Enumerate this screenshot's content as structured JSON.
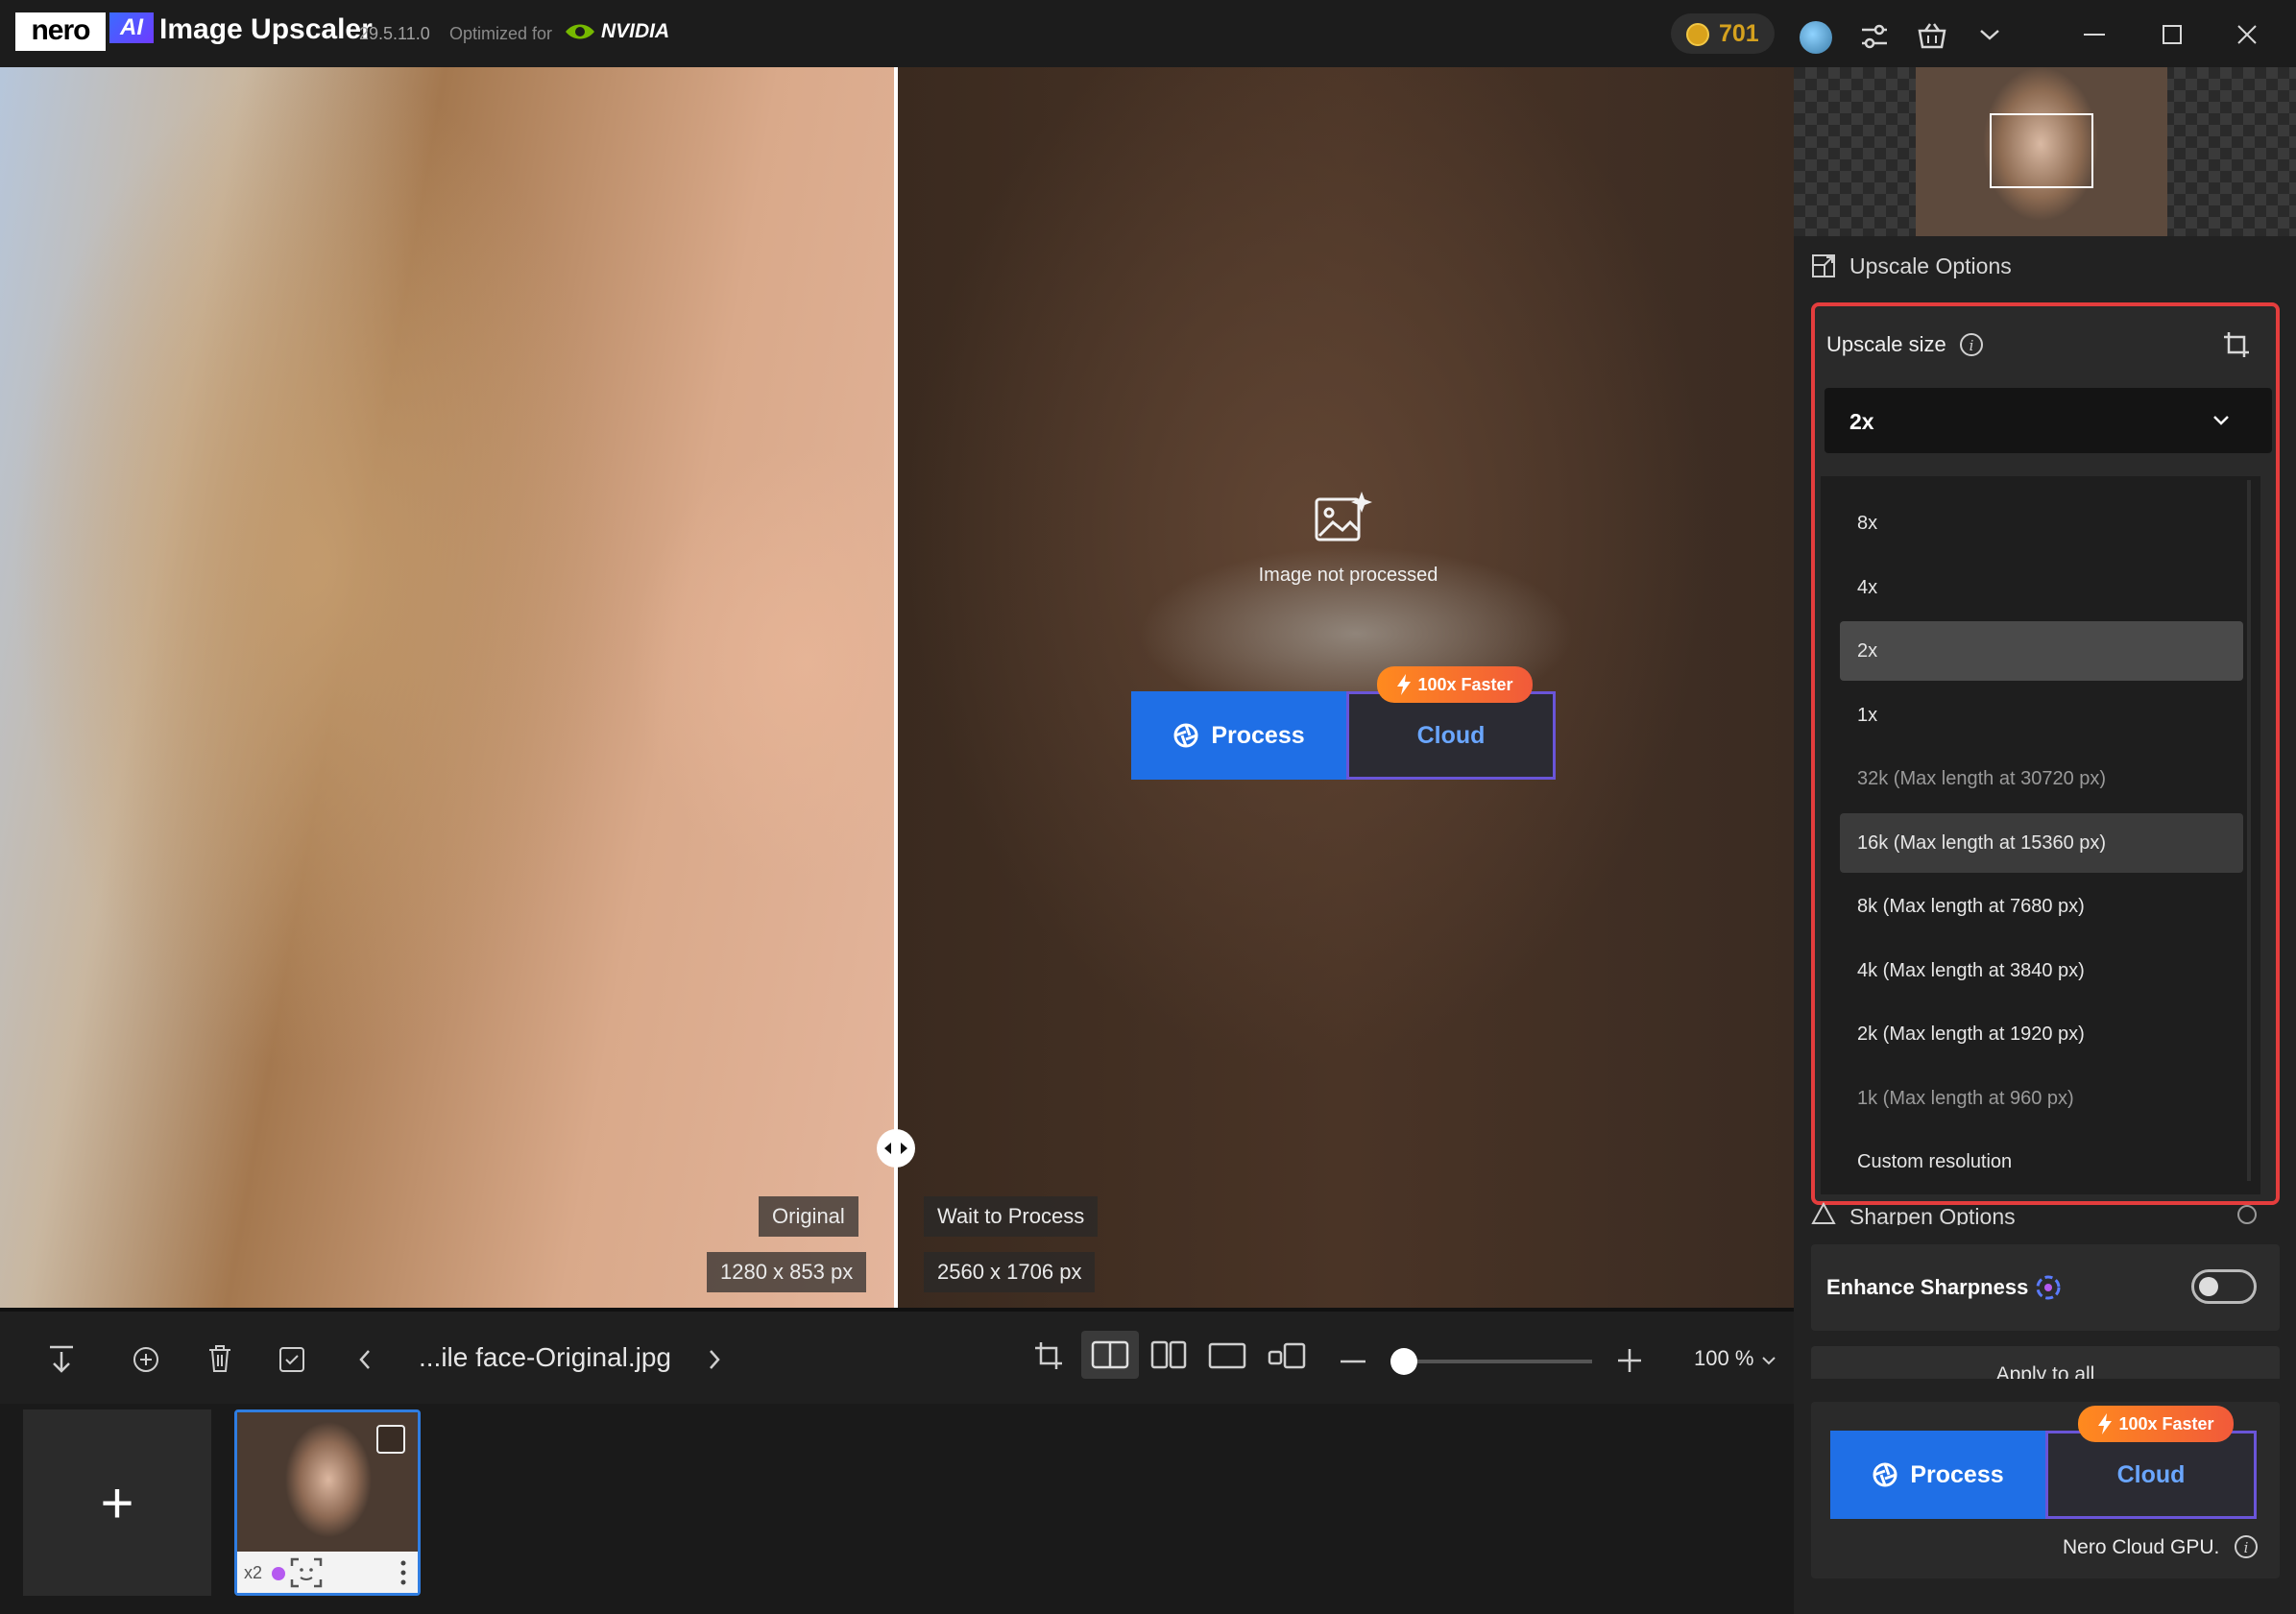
{
  "titlebar": {
    "brand": "nero",
    "ai_badge": "AI",
    "app_name": "Image Upscaler",
    "version": "29.5.11.0",
    "optimized_for": "Optimized for",
    "nvidia": "NVIDIA",
    "credits": "701"
  },
  "canvas": {
    "original_label": "Original",
    "original_size": "1280 x 853 px",
    "processed_label": "Wait to Process",
    "processed_size": "2560 x 1706 px",
    "not_processed": "Image not processed",
    "process_button": "Process",
    "cloud_button": "Cloud",
    "faster_badge": "100x Faster"
  },
  "panel": {
    "upscale_options_title": "Upscale Options",
    "upscale_size_label": "Upscale size",
    "selected_size": "2x",
    "menu_items": [
      {
        "label": "8x",
        "state": "normal"
      },
      {
        "label": "4x",
        "state": "normal"
      },
      {
        "label": "2x",
        "state": "selected"
      },
      {
        "label": "1x",
        "state": "normal"
      },
      {
        "label": "32k (Max length at 30720 px)",
        "state": "dim"
      },
      {
        "label": "16k (Max length at 15360 px)",
        "state": "hover"
      },
      {
        "label": "8k (Max length at 7680 px)",
        "state": "normal"
      },
      {
        "label": "4k (Max length at 3840 px)",
        "state": "normal"
      },
      {
        "label": "2k (Max length at 1920 px)",
        "state": "normal"
      },
      {
        "label": "1k (Max length at 960 px)",
        "state": "dim"
      },
      {
        "label": "Custom resolution",
        "state": "normal"
      }
    ],
    "sharpen_title": "Sharpen Options",
    "enhance_sharpness": "Enhance Sharpness",
    "enhance_on": false,
    "apply_to_all": "Apply to all",
    "process_button": "Process",
    "cloud_button": "Cloud",
    "faster_badge": "100x Faster",
    "cloud_gpu_note": "Nero Cloud GPU."
  },
  "toolbar": {
    "file_name": "...ile face-Original.jpg",
    "zoom": "100 %",
    "zoom_slider": 0
  },
  "filmstrip": {
    "add_label": "+",
    "thumb_scale": "x2"
  },
  "colors": {
    "accent_blue": "#1f6fe6",
    "highlight_red": "#e43d3d",
    "coin_gold": "#d5a11e",
    "badge_orange": "#ff8a1e"
  }
}
